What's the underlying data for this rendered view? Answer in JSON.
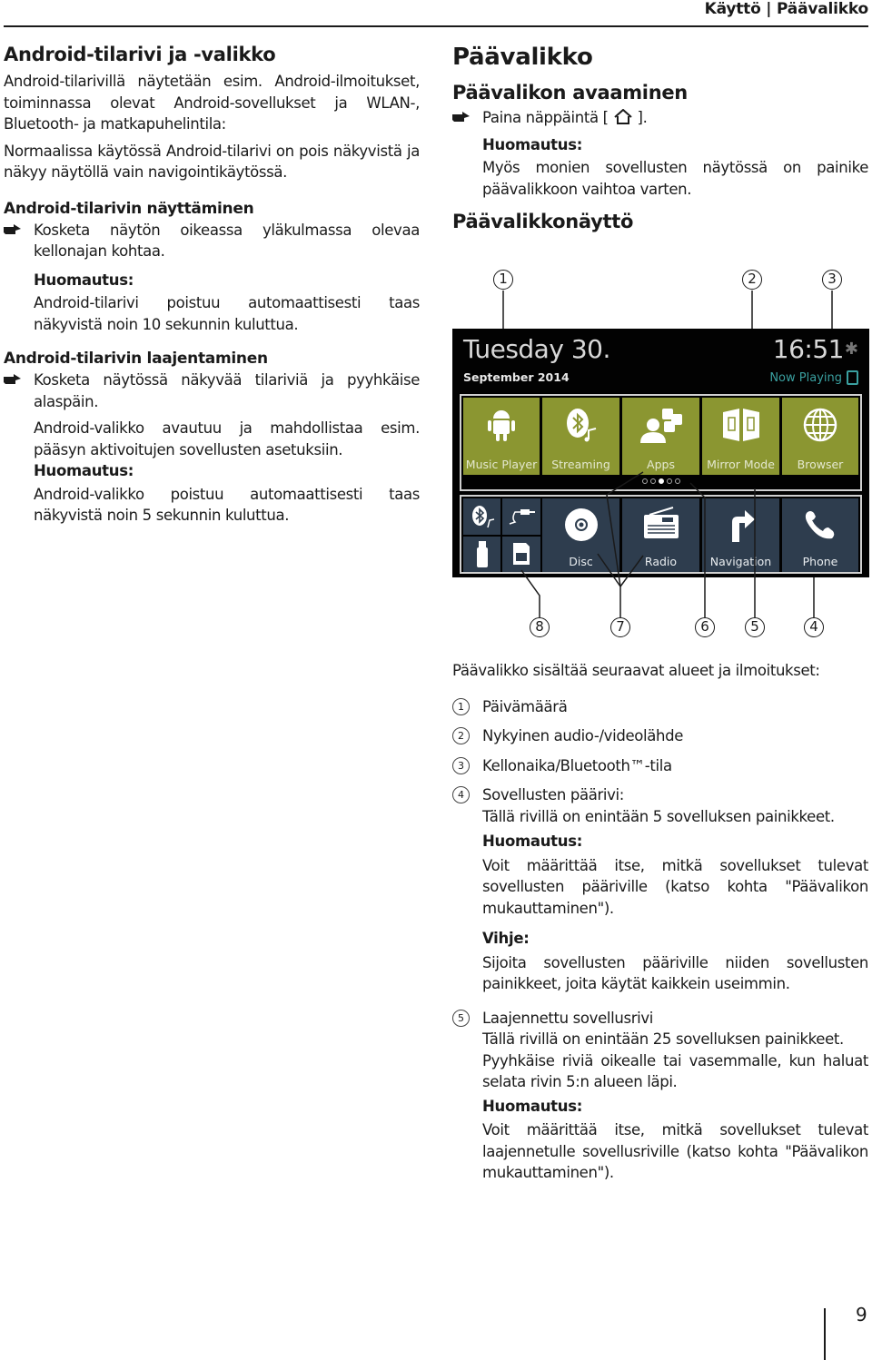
{
  "header": {
    "title": "Käyttö | Päävalikko"
  },
  "left": {
    "heading": "Android-tilarivi ja -valikko",
    "intro": "Android-tilarivillä näytetään esim. Android-ilmoitukset, toiminnassa olevat Android-sovellukset ja WLAN-, Bluetooth- ja matkapuhelintila:",
    "intro2": "Normaalissa käytössä Android-tilarivi on pois näkyvistä ja näkyy näytöllä vain navigointikäytössä.",
    "sec1": {
      "title": "Android-tilarivin näyttäminen",
      "step": "Kosketa näytön oikeassa yläkulmassa olevaa kellonajan kohtaa.",
      "note_label": "Huomautus:",
      "note": "Android-tilarivi poistuu automaattisesti taas näkyvistä noin 10 sekunnin kuluttua."
    },
    "sec2": {
      "title": "Android-tilarivin laajentaminen",
      "step": "Kosketa näytössä näkyvää tilariviä ja pyyhkäise alaspäin.",
      "result": "Android-valikko avautuu ja mahdollistaa esim. pääsyn aktivoitujen sovellusten asetuksiin.",
      "note_label": "Huomautus:",
      "note": "Android-valikko poistuu automaattisesti taas näkyvistä noin 5 sekunnin kuluttua."
    }
  },
  "right": {
    "heading": "Päävalikko",
    "open": {
      "title": "Päävalikon avaaminen",
      "step_pre": "Paina näppäintä [",
      "step_icon": "home-icon",
      "step_post": "].",
      "note_label": "Huomautus:",
      "note": "Myös monien sovellusten näytössä on painike päävalikkoon vaihtoa varten."
    },
    "screen_title": "Päävalikkonäyttö",
    "screen": {
      "day": "Tuesday 30.",
      "month_year": "September 2014",
      "time": "16:51",
      "now_playing": "Now Playing",
      "main_row": [
        {
          "label": "Music Player",
          "icon": "android-icon"
        },
        {
          "label": "Streaming",
          "icon": "bluetooth-music-icon"
        },
        {
          "label": "Apps",
          "icon": "apps-icon"
        },
        {
          "label": "Mirror Mode",
          "icon": "mirror-mode-icon"
        },
        {
          "label": "Browser",
          "icon": "globe-icon"
        }
      ],
      "pager": {
        "pages": 5,
        "active": 3
      },
      "sources": [
        "bluetooth-audio-icon",
        "aux-cable-icon",
        "usb-icon",
        "sd-card-icon"
      ],
      "ext_row": [
        {
          "label": "Disc",
          "icon": "disc-icon"
        },
        {
          "label": "Radio",
          "icon": "radio-icon"
        },
        {
          "label": "Navigation",
          "icon": "navigation-icon"
        },
        {
          "label": "Phone",
          "icon": "phone-icon"
        }
      ],
      "colors": {
        "main_tile": "#8b9631",
        "ext_tile": "#2e3d4e",
        "now_playing": "#3aa0a0"
      }
    },
    "callouts_top": [
      "1",
      "2",
      "3"
    ],
    "callouts_bottom": [
      "8",
      "7",
      "6",
      "5",
      "4"
    ],
    "contents_intro": "Päävalikko sisältää seuraavat alueet ja ilmoitukset:",
    "items": [
      {
        "num": "1",
        "text": "Päivämäärä"
      },
      {
        "num": "2",
        "text": "Nykyinen audio-/videolähde"
      },
      {
        "num": "3",
        "text": "Kellonaika/Bluetooth™-tila"
      },
      {
        "num": "4",
        "text": "Sovellusten päärivi:",
        "sub": "Tällä rivillä on enintään 5 sovelluksen painikkeet.",
        "note_label": "Huomautus:",
        "note": "Voit määrittää itse, mitkä sovellukset tulevat sovellusten pääriville (katso kohta \"Päävalikon mukauttaminen\").",
        "tip_label": "Vihje:",
        "tip": "Sijoita sovellusten pääriville niiden sovellusten painikkeet, joita käytät kaikkein useimmin."
      },
      {
        "num": "5",
        "text": "Laajennettu sovellusrivi",
        "sub": "Tällä rivillä on enintään 25 sovelluksen painikkeet.",
        "sub2": "Pyyhkäise riviä oikealle tai vasemmalle, kun haluat selata rivin 5:n alueen läpi.",
        "note_label": "Huomautus:",
        "note": "Voit määrittää itse, mitkä sovellukset tulevat laajennetulle sovellusriville (katso kohta \"Päävalikon mukauttaminen\")."
      }
    ]
  },
  "footer": {
    "page_number": "9"
  }
}
